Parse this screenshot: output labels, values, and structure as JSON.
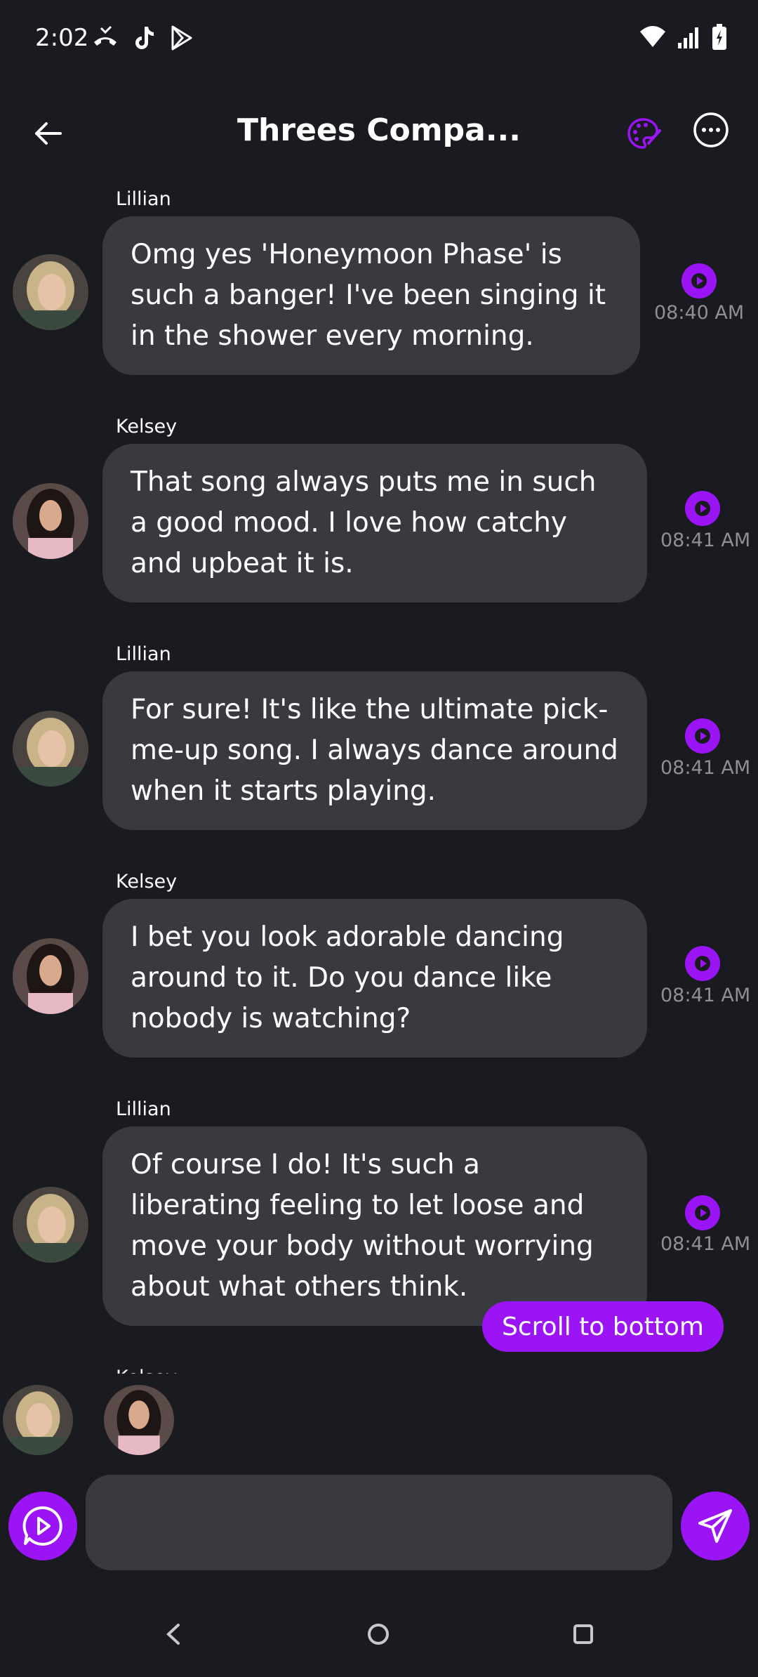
{
  "status_bar": {
    "time": "2:02"
  },
  "header": {
    "title": "Threes Compa..."
  },
  "messages": [
    {
      "sender": "Lillian",
      "text": "Omg yes 'Honeymoon Phase' is such a banger! I've been singing it in the shower every morning.",
      "time": "08:40 AM"
    },
    {
      "sender": "Kelsey",
      "text": "That song always puts me in such a good mood. I love how catchy and upbeat it is.",
      "time": "08:41 AM"
    },
    {
      "sender": "Lillian",
      "text": "For sure! It's like the ultimate pick-me-up song. I always dance around when it starts playing.",
      "time": "08:41 AM"
    },
    {
      "sender": "Kelsey",
      "text": "I bet you look adorable dancing around to it. Do you dance like nobody is watching?",
      "time": "08:41 AM"
    },
    {
      "sender": "Lillian",
      "text": "Of course I do! It's such a liberating feeling to let loose and move your body without worrying about what others think.",
      "time": "08:41 AM"
    }
  ],
  "peek_sender": "Kelsey",
  "scroll_button": {
    "label": "Scroll to bottom"
  },
  "composer": {
    "placeholder": ""
  },
  "colors": {
    "background": "#1a1b20",
    "bubble": "#393a40",
    "accent": "#9b14f5",
    "timestamp": "#8e8f96"
  }
}
